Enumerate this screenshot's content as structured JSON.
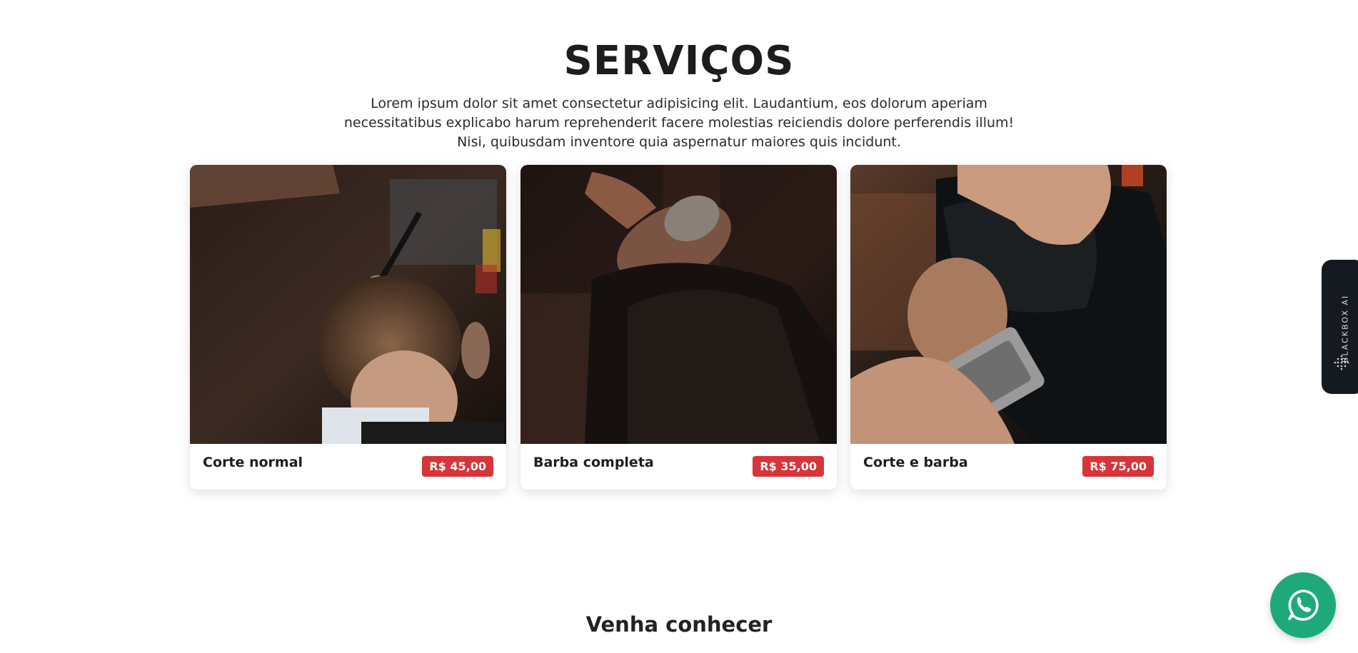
{
  "services": {
    "title": "SERVIÇOS",
    "description": "Lorem ipsum dolor sit amet consectetur adipisicing elit. Laudantium, eos dolorum aperiam necessitatibus explicabo harum reprehenderit facere molestias reiciendis dolore perferendis illum! Nisi, quibusdam inventore quia aspernatur maiores quis incidunt.",
    "items": [
      {
        "name": "Corte normal",
        "price": "R$ 45,00"
      },
      {
        "name": "Barba completa",
        "price": "R$ 35,00"
      },
      {
        "name": "Corte e barba",
        "price": "R$ 75,00"
      }
    ]
  },
  "side_tab": {
    "label": "BLACKBOX AI"
  },
  "next_section": {
    "title": "Venha conhecer"
  },
  "colors": {
    "price_badge": "#d6353a",
    "whatsapp": "#1ea97c",
    "side_tab": "#151a21"
  },
  "icons": {
    "float_button": "whatsapp-icon",
    "side_tab": "dot-grid-icon"
  }
}
